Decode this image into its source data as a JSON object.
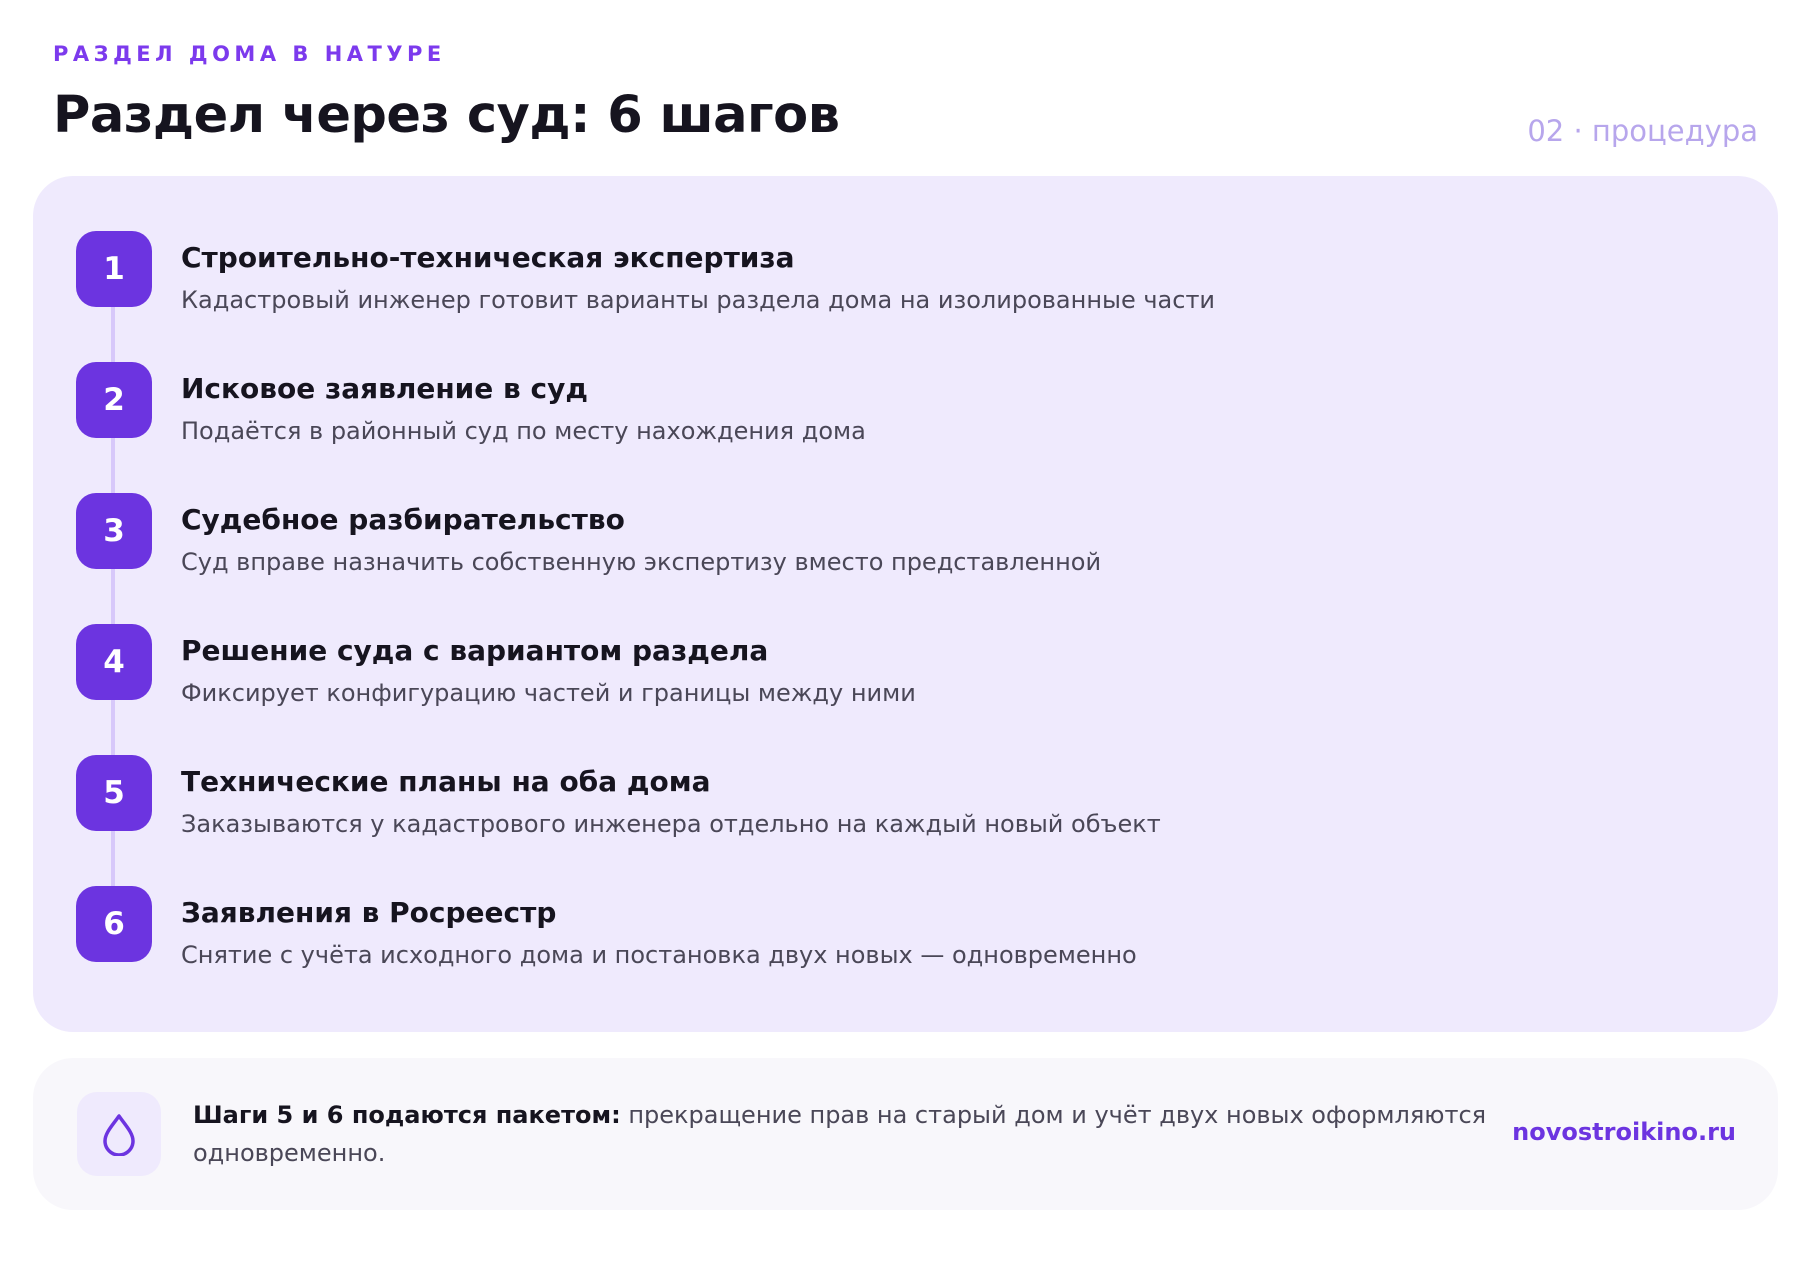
{
  "header": {
    "eyebrow": "РАЗДЕЛ ДОМА В НАТУРЕ",
    "title": "Раздел через суд: 6 шагов",
    "section_tag": "02 · процедура"
  },
  "steps": [
    {
      "number": "1",
      "title": "Строительно-техническая экспертиза",
      "description": "Кадастровый инженер готовит варианты раздела дома на изолированные части"
    },
    {
      "number": "2",
      "title": "Исковое заявление в суд",
      "description": "Подаётся в районный суд по месту нахождения дома"
    },
    {
      "number": "3",
      "title": "Судебное разбирательство",
      "description": "Суд вправе назначить собственную экспертизу вместо представленной"
    },
    {
      "number": "4",
      "title": "Решение суда с вариантом раздела",
      "description": "Фиксирует конфигурацию частей и границы между ними"
    },
    {
      "number": "5",
      "title": "Технические планы на оба дома",
      "description": "Заказываются у кадастрового инженера отдельно на каждый новый объект"
    },
    {
      "number": "6",
      "title": "Заявления в Росреестр",
      "description": "Снятие с учёта исходного дома и постановка двух новых — одновременно"
    }
  ],
  "note": {
    "icon": "drop-icon",
    "strong": "Шаги 5 и 6 подаются пакетом:",
    "text": " прекращение прав на старый дом и учёт двух новых оформляются одновременно."
  },
  "brand": "novostroikino.ru",
  "colors": {
    "accent": "#6c34e0",
    "card_background": "#efeafd",
    "note_background": "#f8f7fb",
    "section_tag": "#b7a6ec"
  }
}
